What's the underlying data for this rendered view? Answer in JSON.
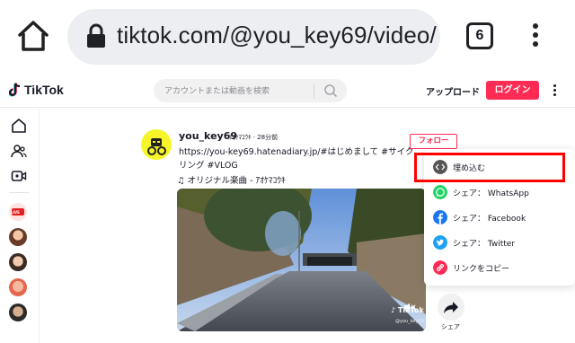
{
  "browser": {
    "url": "tiktok.com/@you_key69/video/",
    "tab_count": "6"
  },
  "header": {
    "logo_text": "TikTok",
    "search_placeholder": "アカウントまたは動画を検索",
    "upload_label": "アップロード",
    "login_label": "ログイン"
  },
  "sidebar": {
    "live_badge": "LIVE"
  },
  "post": {
    "username": "you_key69",
    "nickname_time": "ｱｵｹﾏｺｳｷ · 28分前",
    "description": "https://you-key69.hatenadiary.jp/#はじめまして #サイクリング #VLOG",
    "music": "オリジナル楽曲 - ｱｵｹﾏｺｳｷ",
    "follow_label": "フォロー",
    "video_watermark": "TikTok",
    "video_user": "@you_key69",
    "share_label": "シェア"
  },
  "share_menu": {
    "items": [
      {
        "label": "埋め込む",
        "icon": "embed-icon",
        "color": "#555555"
      },
      {
        "label": "シェア： WhatsApp",
        "icon": "whatsapp-icon",
        "color": "#25d366"
      },
      {
        "label": "シェア： Facebook",
        "icon": "facebook-icon",
        "color": "#1877f2"
      },
      {
        "label": "シェア： Twitter",
        "icon": "twitter-icon",
        "color": "#1da1f2"
      },
      {
        "label": "リンクをコピー",
        "icon": "link-icon",
        "color": "#fe2c55"
      }
    ]
  },
  "colors": {
    "brand": "#fe2c55",
    "highlight": "#ff0000"
  }
}
